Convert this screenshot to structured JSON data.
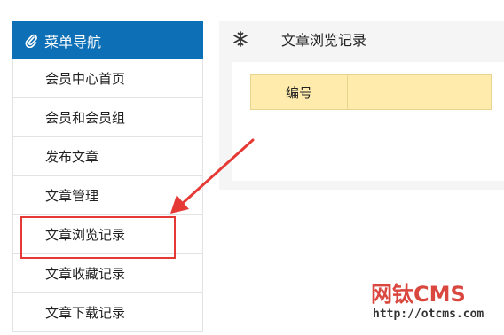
{
  "sidebar": {
    "header_label": "菜单导航",
    "items": [
      {
        "label": "会员中心首页"
      },
      {
        "label": "会员和会员组"
      },
      {
        "label": "发布文章"
      },
      {
        "label": "文章管理"
      },
      {
        "label": "文章浏览记录"
      },
      {
        "label": "文章收藏记录"
      },
      {
        "label": "文章下载记录"
      }
    ]
  },
  "main": {
    "title": "文章浏览记录",
    "table": {
      "columns": [
        "编号",
        ""
      ]
    }
  },
  "watermark": {
    "brand": "网钛CMS",
    "url": "http://otcms.com"
  },
  "colors": {
    "sidebar_header_bg": "#0d6fb6",
    "annotation_red": "#e53935",
    "table_header_bg": "#ffecad",
    "watermark_red": "#d9473f"
  },
  "icons": {
    "sidebar_header": "paperclip-icon",
    "main_title": "snowflake-icon"
  }
}
